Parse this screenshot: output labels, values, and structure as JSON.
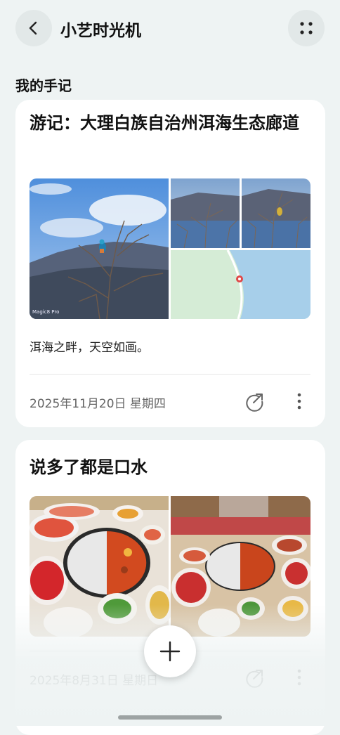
{
  "header": {
    "title": "小艺时光机",
    "back_icon": "chevron-left-icon",
    "more_icon": "four-dots-icon"
  },
  "section": {
    "title": "我的手记"
  },
  "notes": [
    {
      "title": "游记：大理白族自治州洱海生态廊道",
      "text": "洱海之畔，天空如画。",
      "date": "2025年11月20日 星期四",
      "watermark": "Magic8 Pro",
      "photos": [
        "mountain-bird-photo",
        "mountain-bird-photo",
        "mountain-bird-photo",
        "map-thumbnail"
      ]
    },
    {
      "title": "说多了都是口水",
      "date": "2025年8月31日 星期日",
      "photos": [
        "hotpot-photo",
        "hotpot-restaurant-photo"
      ]
    }
  ],
  "fab": {
    "icon": "plus-icon"
  },
  "colors": {
    "background": "#eef3f3",
    "card": "#ffffff",
    "secondary_text": "#666666"
  }
}
